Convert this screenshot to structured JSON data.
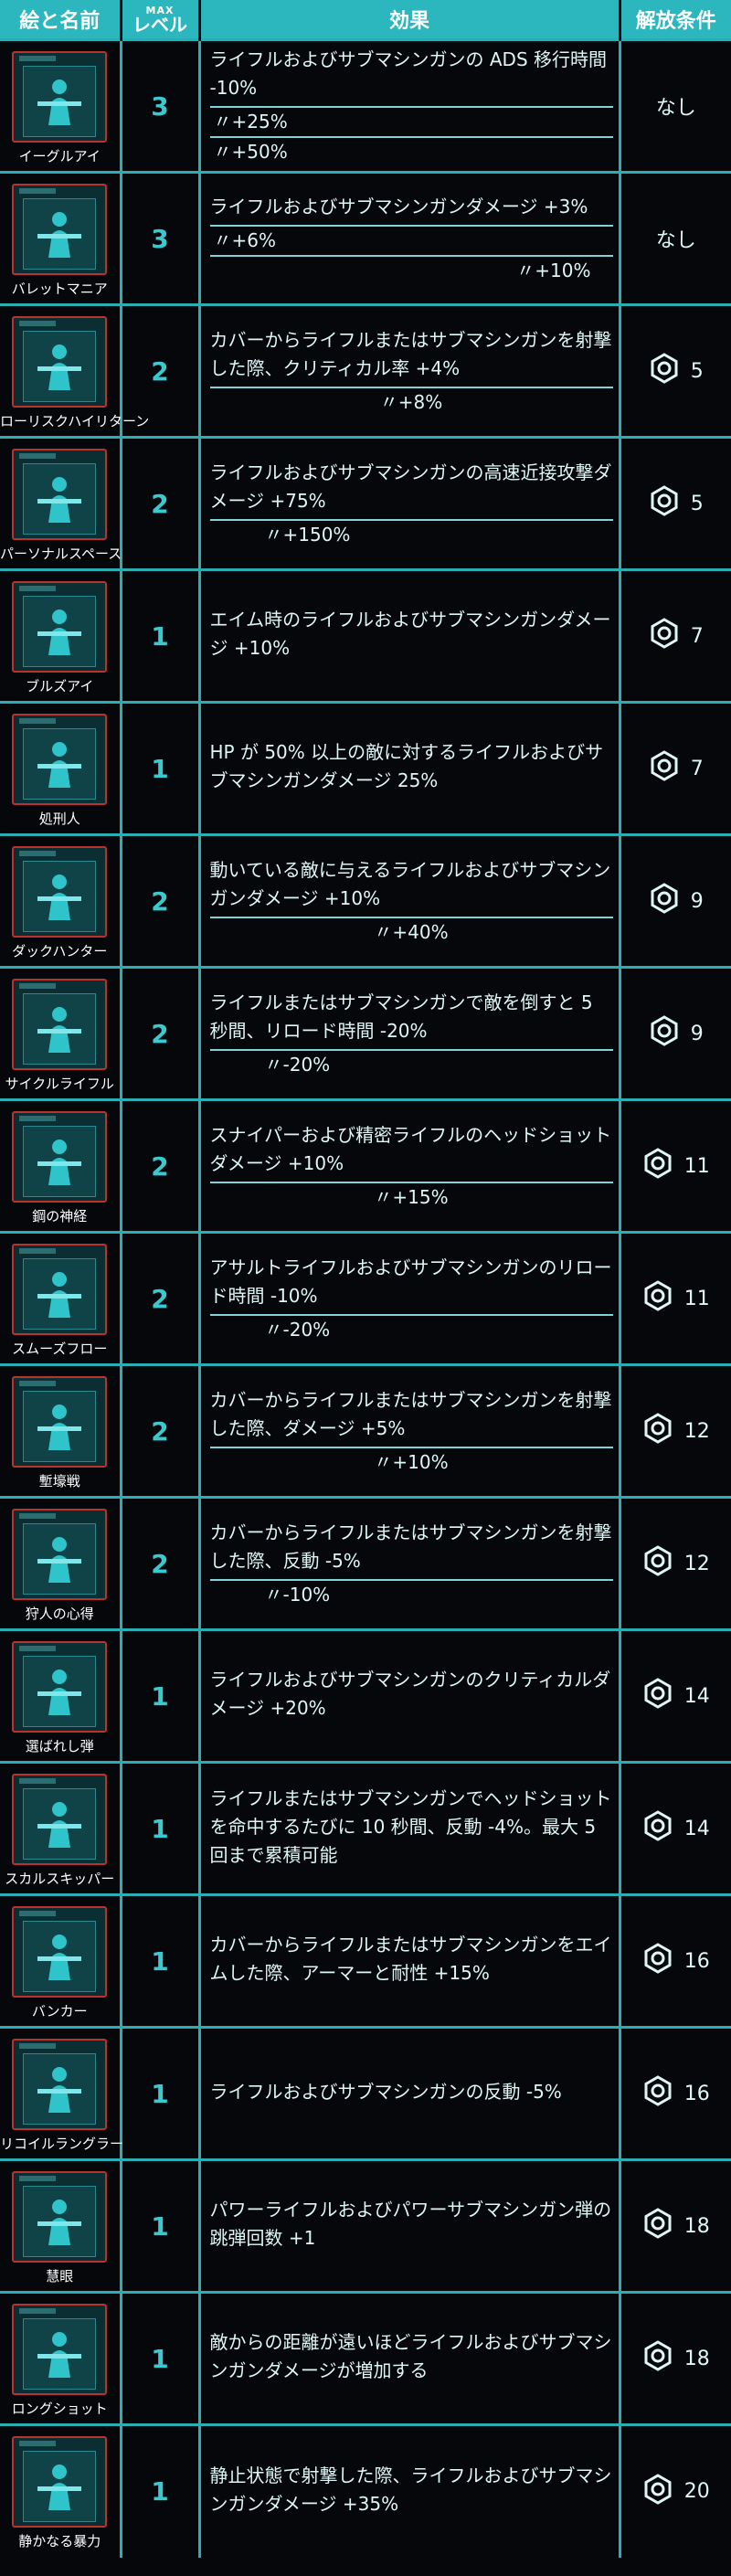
{
  "headers": {
    "picture_name": "絵と名前",
    "max": "MAX",
    "level": "レベル",
    "effect": "効果",
    "unlock": "解放条件"
  },
  "colors": {
    "accent": "#2bb7bd",
    "card_border": "#b8322f"
  },
  "rows": [
    {
      "name": "イーグルアイ",
      "icon": "eagle-eye-icon",
      "level": "3",
      "effect": "ライフルおよびサブマシンガンの ADS 移行時間 -10%",
      "subs": [
        "〃+25%",
        "〃+50%"
      ],
      "unlock": "なし",
      "unlock_icon": ""
    },
    {
      "name": "バレットマニア",
      "icon": "bullet-mania-icon",
      "level": "3",
      "effect": "ライフルおよびサブマシンガンダメージ +3%",
      "subs": [
        "〃+6%",
        "〃+10%"
      ],
      "unlock": "なし",
      "unlock_icon": ""
    },
    {
      "name": "ローリスクハイリターン",
      "icon": "low-risk-high-return-icon",
      "level": "2",
      "effect": "カバーからライフルまたはサブマシンガンを射撃した際、クリティカル率 +4%",
      "subs": [
        "〃+8%"
      ],
      "unlock": "5",
      "unlock_icon": "module-icon"
    },
    {
      "name": "パーソナルスペース",
      "icon": "personal-space-icon",
      "level": "2",
      "effect": "ライフルおよびサブマシンガンの高速近接攻撃ダメージ +75%",
      "subs": [
        "〃+150%"
      ],
      "unlock": "5",
      "unlock_icon": "module-icon"
    },
    {
      "name": "ブルズアイ",
      "icon": "bullseye-icon",
      "level": "1",
      "effect": "エイム時のライフルおよびサブマシンガンダメージ +10%",
      "subs": [],
      "unlock": "7",
      "unlock_icon": "module-icon"
    },
    {
      "name": "処刑人",
      "icon": "executioner-icon",
      "level": "1",
      "effect": "HP が 50% 以上の敵に対するライフルおよびサブマシンガンダメージ 25%",
      "subs": [],
      "unlock": "7",
      "unlock_icon": "module-icon"
    },
    {
      "name": "ダックハンター",
      "icon": "duck-hunter-icon",
      "level": "2",
      "effect": "動いている敵に与えるライフルおよびサブマシンガンダメージ +10%",
      "subs": [
        "〃+40%"
      ],
      "unlock": "9",
      "unlock_icon": "module-icon"
    },
    {
      "name": "サイクルライフル",
      "icon": "cycle-rifle-icon",
      "level": "2",
      "effect": "ライフルまたはサブマシンガンで敵を倒すと 5 秒間、リロード時間 -20%",
      "subs": [
        "〃-20%"
      ],
      "unlock": "9",
      "unlock_icon": "module-icon"
    },
    {
      "name": "鋼の神経",
      "icon": "nerves-of-steel-icon",
      "level": "2",
      "effect": "スナイパーおよび精密ライフルのヘッドショットダメージ +10%",
      "subs": [
        "〃+15%"
      ],
      "unlock": "11",
      "unlock_icon": "module-icon"
    },
    {
      "name": "スムーズフロー",
      "icon": "smooth-flow-icon",
      "level": "2",
      "effect": "アサルトライフルおよびサブマシンガンのリロード時間 -10%",
      "subs": [
        "〃-20%"
      ],
      "unlock": "11",
      "unlock_icon": "module-icon"
    },
    {
      "name": "塹壕戦",
      "icon": "trench-warfare-icon",
      "level": "2",
      "effect": "カバーからライフルまたはサブマシンガンを射撃した際、ダメージ +5%",
      "subs": [
        "〃+10%"
      ],
      "unlock": "12",
      "unlock_icon": "module-icon"
    },
    {
      "name": "狩人の心得",
      "icon": "hunters-focus-icon",
      "level": "2",
      "effect": "カバーからライフルまたはサブマシンガンを射撃した際、反動 -5%",
      "subs": [
        "〃-10%"
      ],
      "unlock": "12",
      "unlock_icon": "module-icon"
    },
    {
      "name": "選ばれし弾",
      "icon": "chosen-bullet-icon",
      "level": "1",
      "effect": "ライフルおよびサブマシンガンのクリティカルダメージ +20%",
      "subs": [],
      "unlock": "14",
      "unlock_icon": "module-icon"
    },
    {
      "name": "スカルスキッパー",
      "icon": "skull-skipper-icon",
      "level": "1",
      "effect": "ライフルまたはサブマシンガンでヘッドショットを命中するたびに 10 秒間、反動 -4%。最大 5 回まで累積可能",
      "subs": [],
      "unlock": "14",
      "unlock_icon": "module-icon"
    },
    {
      "name": "バンカー",
      "icon": "bunker-icon",
      "level": "1",
      "effect": "カバーからライフルまたはサブマシンガンをエイムした際、アーマーと耐性 +15%",
      "subs": [],
      "unlock": "16",
      "unlock_icon": "module-icon"
    },
    {
      "name": "リコイルラングラー",
      "icon": "recoil-wrangler-icon",
      "level": "1",
      "effect": "ライフルおよびサブマシンガンの反動 -5%",
      "subs": [],
      "unlock": "16",
      "unlock_icon": "module-icon"
    },
    {
      "name": "慧眼",
      "icon": "keen-eye-icon",
      "level": "1",
      "effect": "パワーライフルおよびパワーサブマシンガン弾の跳弾回数 +1",
      "subs": [],
      "unlock": "18",
      "unlock_icon": "module-icon"
    },
    {
      "name": "ロングショット",
      "icon": "long-shot-icon",
      "level": "1",
      "effect": "敵からの距離が遠いほどライフルおよびサブマシンガンダメージが増加する",
      "subs": [],
      "unlock": "18",
      "unlock_icon": "module-icon"
    },
    {
      "name": "静かなる暴力",
      "icon": "quiet-violence-icon",
      "level": "1",
      "effect": "静止状態で射撃した際、ライフルおよびサブマシンガンダメージ +35%",
      "subs": [],
      "unlock": "20",
      "unlock_icon": "module-icon"
    }
  ]
}
